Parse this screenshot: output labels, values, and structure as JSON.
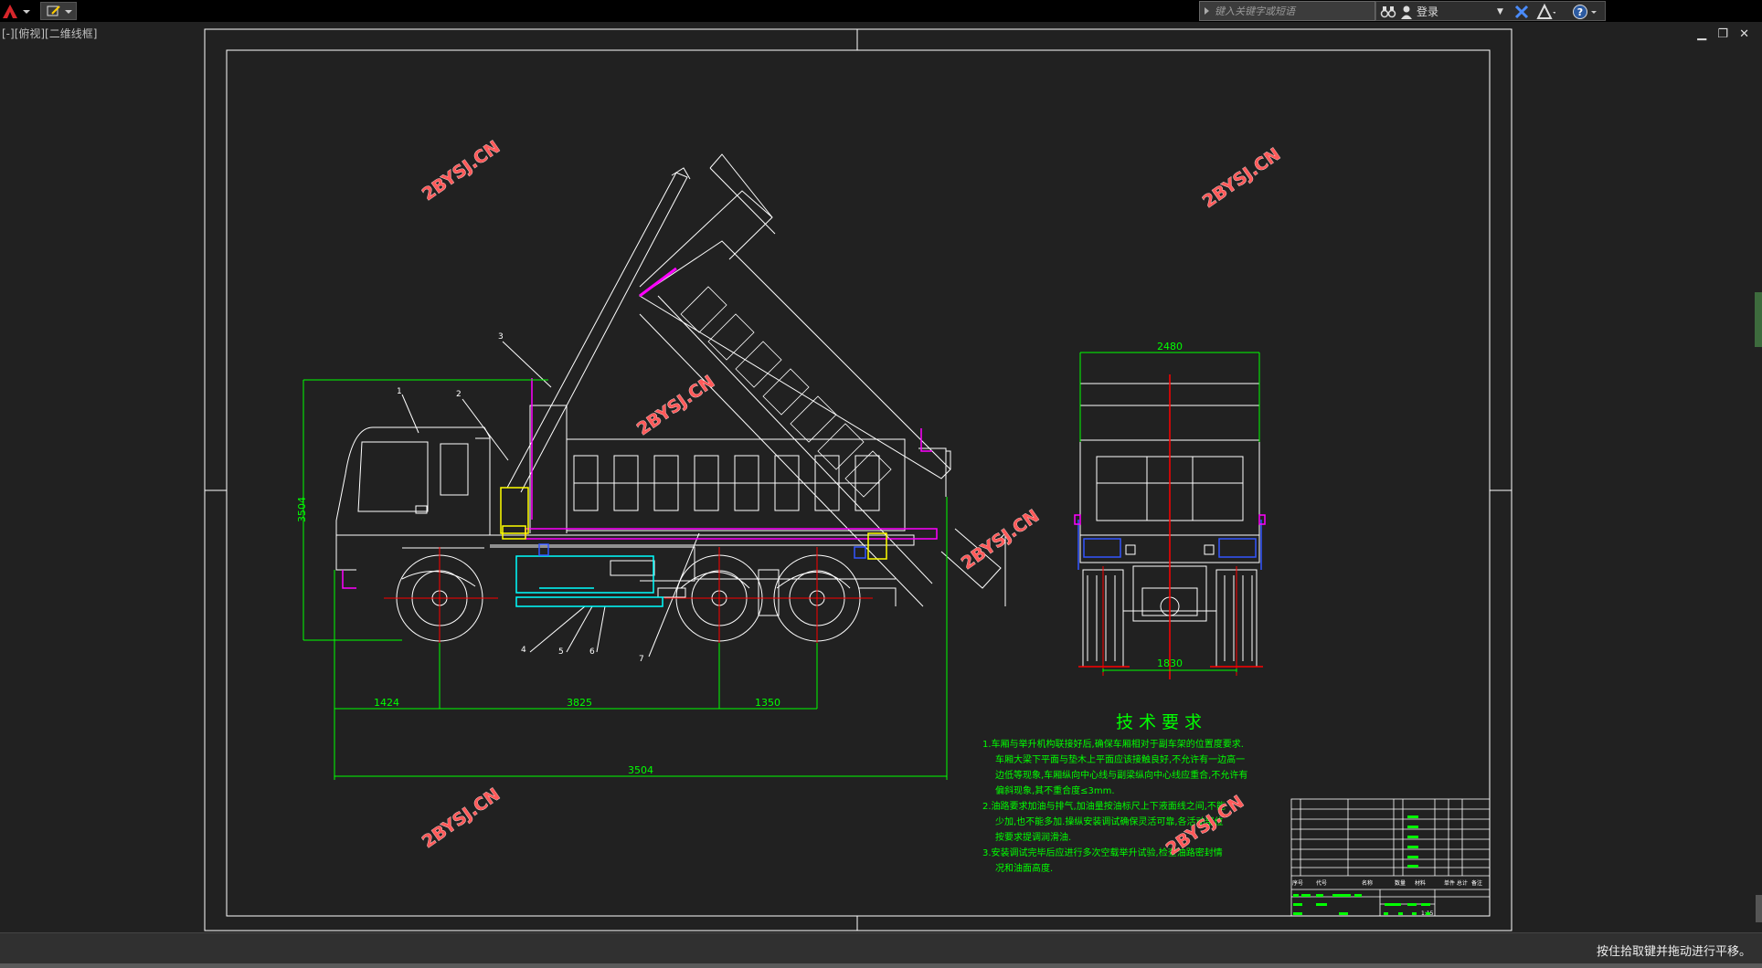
{
  "toolbar": {
    "search_placeholder": "键入关键字或短语",
    "login_label": "登录"
  },
  "viewport": {
    "label": "[-][俯视][二维线框]"
  },
  "drawing": {
    "watermark": "2BYSJ.CN",
    "part_labels": [
      "1",
      "2",
      "3",
      "4",
      "5",
      "6",
      "7"
    ],
    "dimensions": {
      "height": "3504",
      "front_overhang": "1424",
      "wheelbase": "3825",
      "rear_axle_spacing": "1350",
      "total": "3504",
      "width_top": "2480",
      "width_bottom": "1830"
    },
    "tech_title": "技 术 要 求",
    "tech_lines": [
      "1.车厢与举升机构联接好后,确保车厢相对于副车架的位置度要求.",
      "车厢大梁下平面与垫木上平面应该接触良好,不允许有一边高一",
      "边低等现象,车厢纵向中心线与副梁纵向中心线应重合,不允许有",
      "偏斜现象,其不重合度≤3mm.",
      "2.油路要求加油与排气,加油量按油标尺上下液面线之间,不能",
      "少加,也不能多加.操纵安装调试确保灵活可靠,各活动部位",
      "按要求提调润滑油.",
      "3.安装调试完毕后应进行多次空载举升试验,检查油路密封情",
      "况和油面高度."
    ],
    "title_block": {
      "headers": [
        "序号",
        "代号",
        "名称",
        "数量",
        "材料",
        "单件 总计",
        "备注"
      ],
      "scale": "1:15"
    }
  },
  "status": {
    "text": "按住拾取键并拖动进行平移。"
  },
  "colors": {
    "line": "#ffffff",
    "dimension": "#00ff00",
    "magenta": "#ff00ff",
    "cyan": "#00ffff",
    "red": "#ff0000",
    "yellow": "#ffff00",
    "blue": "#3355ff"
  }
}
